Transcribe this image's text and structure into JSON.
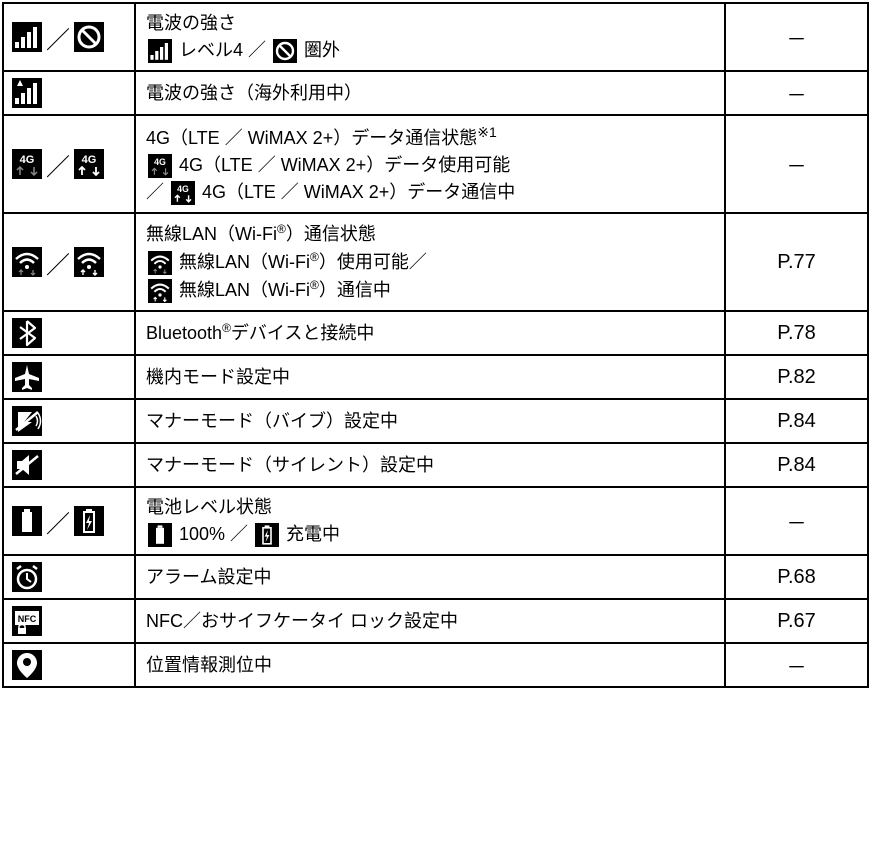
{
  "rows": [
    {
      "icons": [
        "signal-bars",
        "no-signal"
      ],
      "lines": [
        {
          "text": "電波の強さ"
        },
        {
          "parts": [
            {
              "icon": "signal-bars"
            },
            {
              "text": " レベル4 ／ "
            },
            {
              "icon": "no-signal"
            },
            {
              "text": " 圏外"
            }
          ]
        }
      ],
      "page": "－"
    },
    {
      "icons": [
        "signal-roaming"
      ],
      "lines": [
        {
          "text": "電波の強さ（海外利用中）"
        }
      ],
      "page": "－"
    },
    {
      "icons": [
        "4g-idle",
        "4g-active"
      ],
      "lines": [
        {
          "parts": [
            {
              "text": "4G（LTE ／ WiMAX 2+）データ通信状態"
            },
            {
              "sup": "※1"
            }
          ]
        },
        {
          "parts": [
            {
              "icon": "4g-idle"
            },
            {
              "text": " 4G（LTE ／ WiMAX 2+）データ使用可能"
            }
          ]
        },
        {
          "parts": [
            {
              "text": "／ "
            },
            {
              "icon": "4g-active"
            },
            {
              "text": " 4G（LTE ／ WiMAX 2+）データ通信中"
            }
          ]
        }
      ],
      "page": "－"
    },
    {
      "icons": [
        "wifi-idle",
        "wifi-active"
      ],
      "lines": [
        {
          "parts": [
            {
              "text": "無線LAN（Wi-Fi"
            },
            {
              "reg": true
            },
            {
              "text": "）通信状態"
            }
          ]
        },
        {
          "parts": [
            {
              "icon": "wifi-idle"
            },
            {
              "text": " 無線LAN（Wi-Fi"
            },
            {
              "reg": true
            },
            {
              "text": "）使用可能／"
            }
          ]
        },
        {
          "parts": [
            {
              "icon": "wifi-active"
            },
            {
              "text": " 無線LAN（Wi-Fi"
            },
            {
              "reg": true
            },
            {
              "text": "）通信中"
            }
          ]
        }
      ],
      "page": "P.77"
    },
    {
      "icons": [
        "bluetooth"
      ],
      "lines": [
        {
          "parts": [
            {
              "text": "Bluetooth"
            },
            {
              "reg": true
            },
            {
              "text": "デバイスと接続中"
            }
          ]
        }
      ],
      "page": "P.78"
    },
    {
      "icons": [
        "airplane"
      ],
      "lines": [
        {
          "text": "機内モード設定中"
        }
      ],
      "page": "P.82"
    },
    {
      "icons": [
        "vibrate"
      ],
      "lines": [
        {
          "text": "マナーモード（バイブ）設定中"
        }
      ],
      "page": "P.84"
    },
    {
      "icons": [
        "silent"
      ],
      "lines": [
        {
          "text": "マナーモード（サイレント）設定中"
        }
      ],
      "page": "P.84"
    },
    {
      "icons": [
        "battery",
        "charging"
      ],
      "lines": [
        {
          "text": "電池レベル状態"
        },
        {
          "parts": [
            {
              "icon": "battery"
            },
            {
              "text": " 100% ／ "
            },
            {
              "icon": "charging"
            },
            {
              "text": " 充電中"
            }
          ]
        }
      ],
      "page": "－"
    },
    {
      "icons": [
        "alarm"
      ],
      "lines": [
        {
          "text": "アラーム設定中"
        }
      ],
      "page": "P.68"
    },
    {
      "icons": [
        "nfc-lock"
      ],
      "lines": [
        {
          "text": "NFC／おサイフケータイ ロック設定中"
        }
      ],
      "page": "P.67"
    },
    {
      "icons": [
        "location"
      ],
      "lines": [
        {
          "text": "位置情報測位中"
        }
      ],
      "page": "－"
    }
  ]
}
